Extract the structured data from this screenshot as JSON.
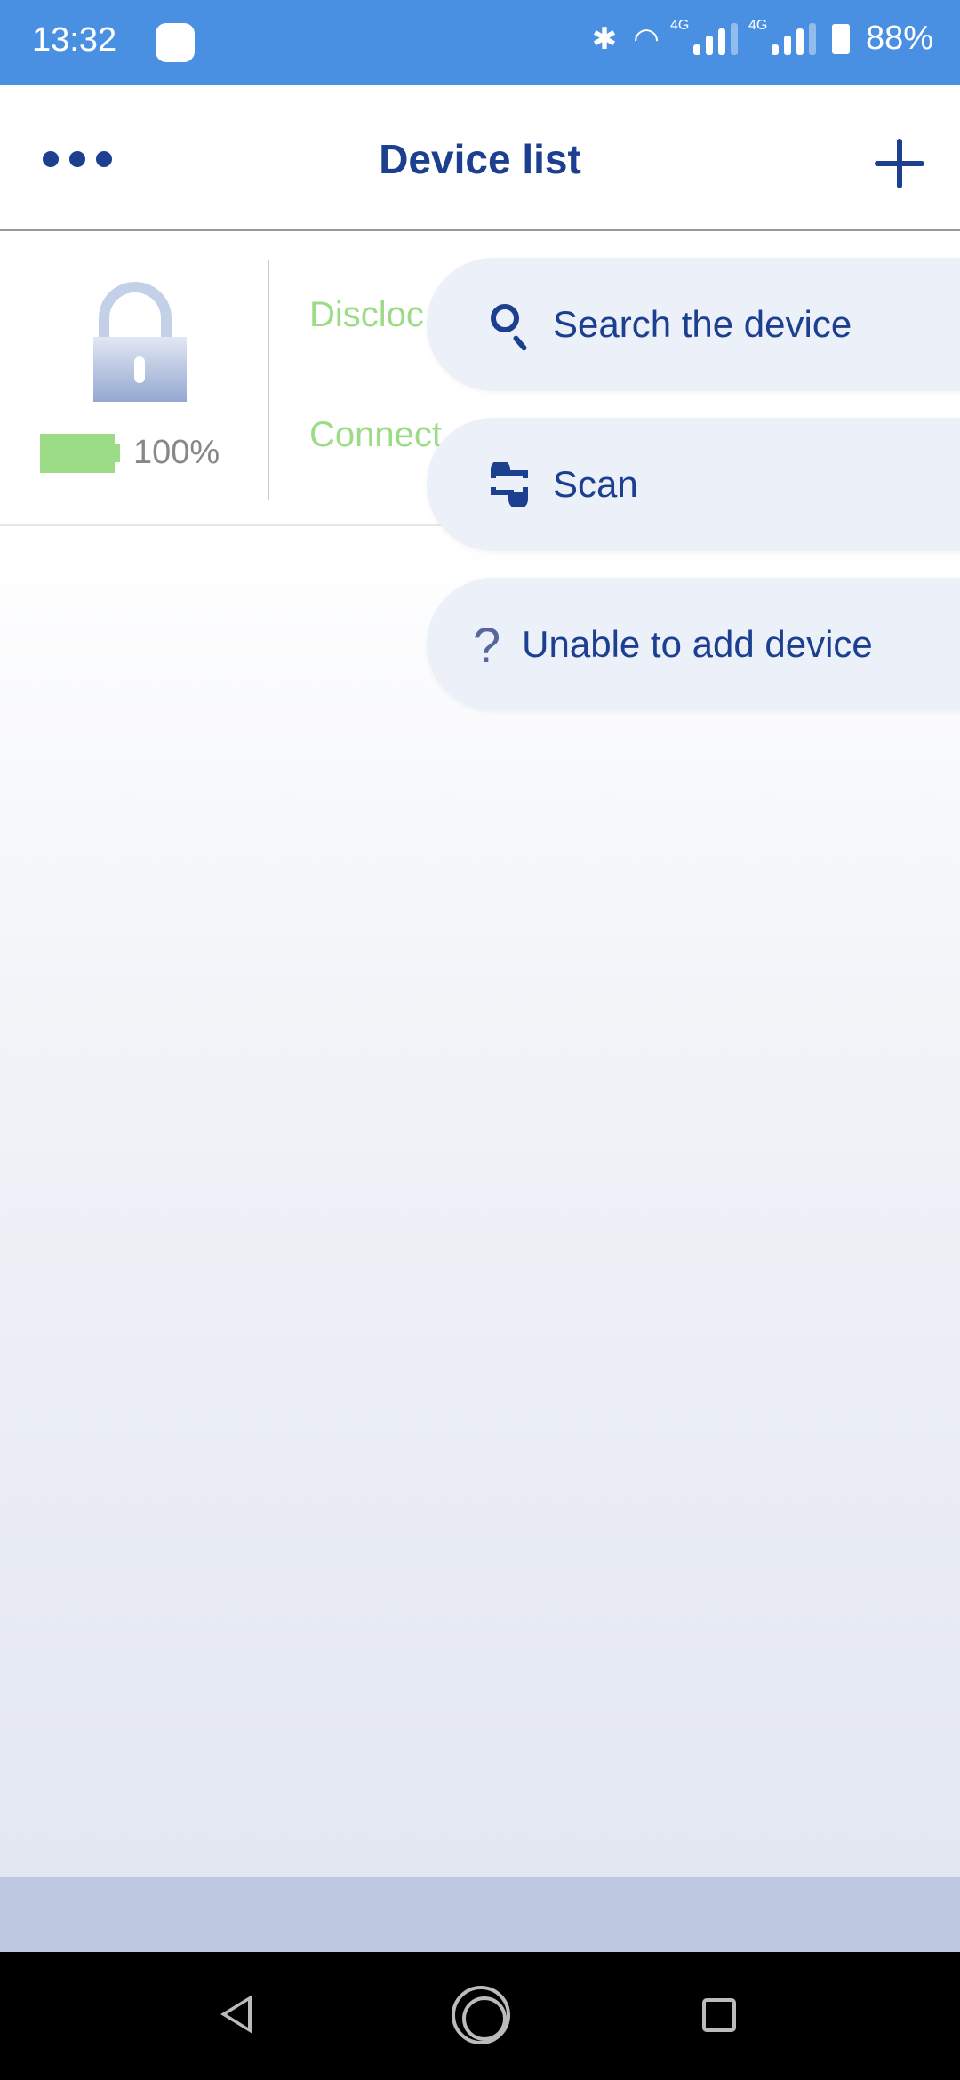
{
  "status_bar": {
    "time": "13:32",
    "network_1": "4G",
    "network_2": "4G",
    "battery": "88%"
  },
  "header": {
    "title": "Device list"
  },
  "device": {
    "battery_level_percent": 100,
    "battery_label": "100%",
    "label_1": "Discloc",
    "label_2": "Connect",
    "lock_state": "unlocked"
  },
  "menu": {
    "items": [
      {
        "icon": "search-icon",
        "label": "Search the device"
      },
      {
        "icon": "scan-icon",
        "label": "Scan"
      },
      {
        "icon": "question-icon",
        "label": "Unable to add device"
      }
    ]
  },
  "colors": {
    "status_bar": "#4a90e2",
    "accent": "#1c3f8f",
    "battery": "#9ddc87",
    "menu_bg": "#ecf0f8"
  }
}
